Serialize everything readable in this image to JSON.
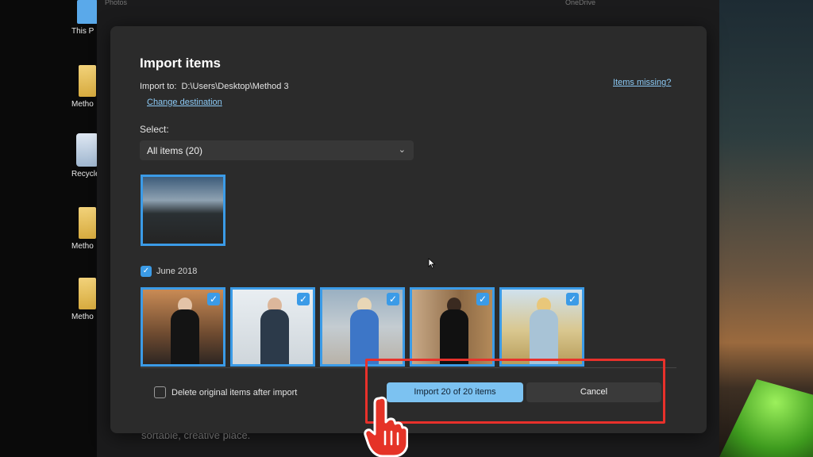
{
  "desktop": {
    "icons": [
      {
        "label": "This P",
        "type": "pc"
      },
      {
        "label": "Metho",
        "type": "folder"
      },
      {
        "label": "Recycle",
        "type": "recycle"
      },
      {
        "label": "Metho",
        "type": "folder"
      },
      {
        "label": "Metho",
        "type": "folder"
      }
    ]
  },
  "background_window": {
    "top_left_text": "Photos",
    "top_right_text": "OneDrive",
    "bottom_text": "sortable, creative place."
  },
  "dialog": {
    "title": "Import items",
    "import_to_label": "Import to:",
    "import_to_path": "D:\\Users\\Desktop\\Method 3",
    "change_destination": "Change destination",
    "items_missing": "Items missing?",
    "select_label": "Select:",
    "select_value": "All items (20)",
    "group_label": "June 2018",
    "delete_label": "Delete original items after import",
    "import_button": "Import 20 of 20 items",
    "cancel_button": "Cancel"
  },
  "colors": {
    "accent": "#3b9be7",
    "primary_button": "#7cc2f1",
    "highlight": "#e8312b"
  }
}
